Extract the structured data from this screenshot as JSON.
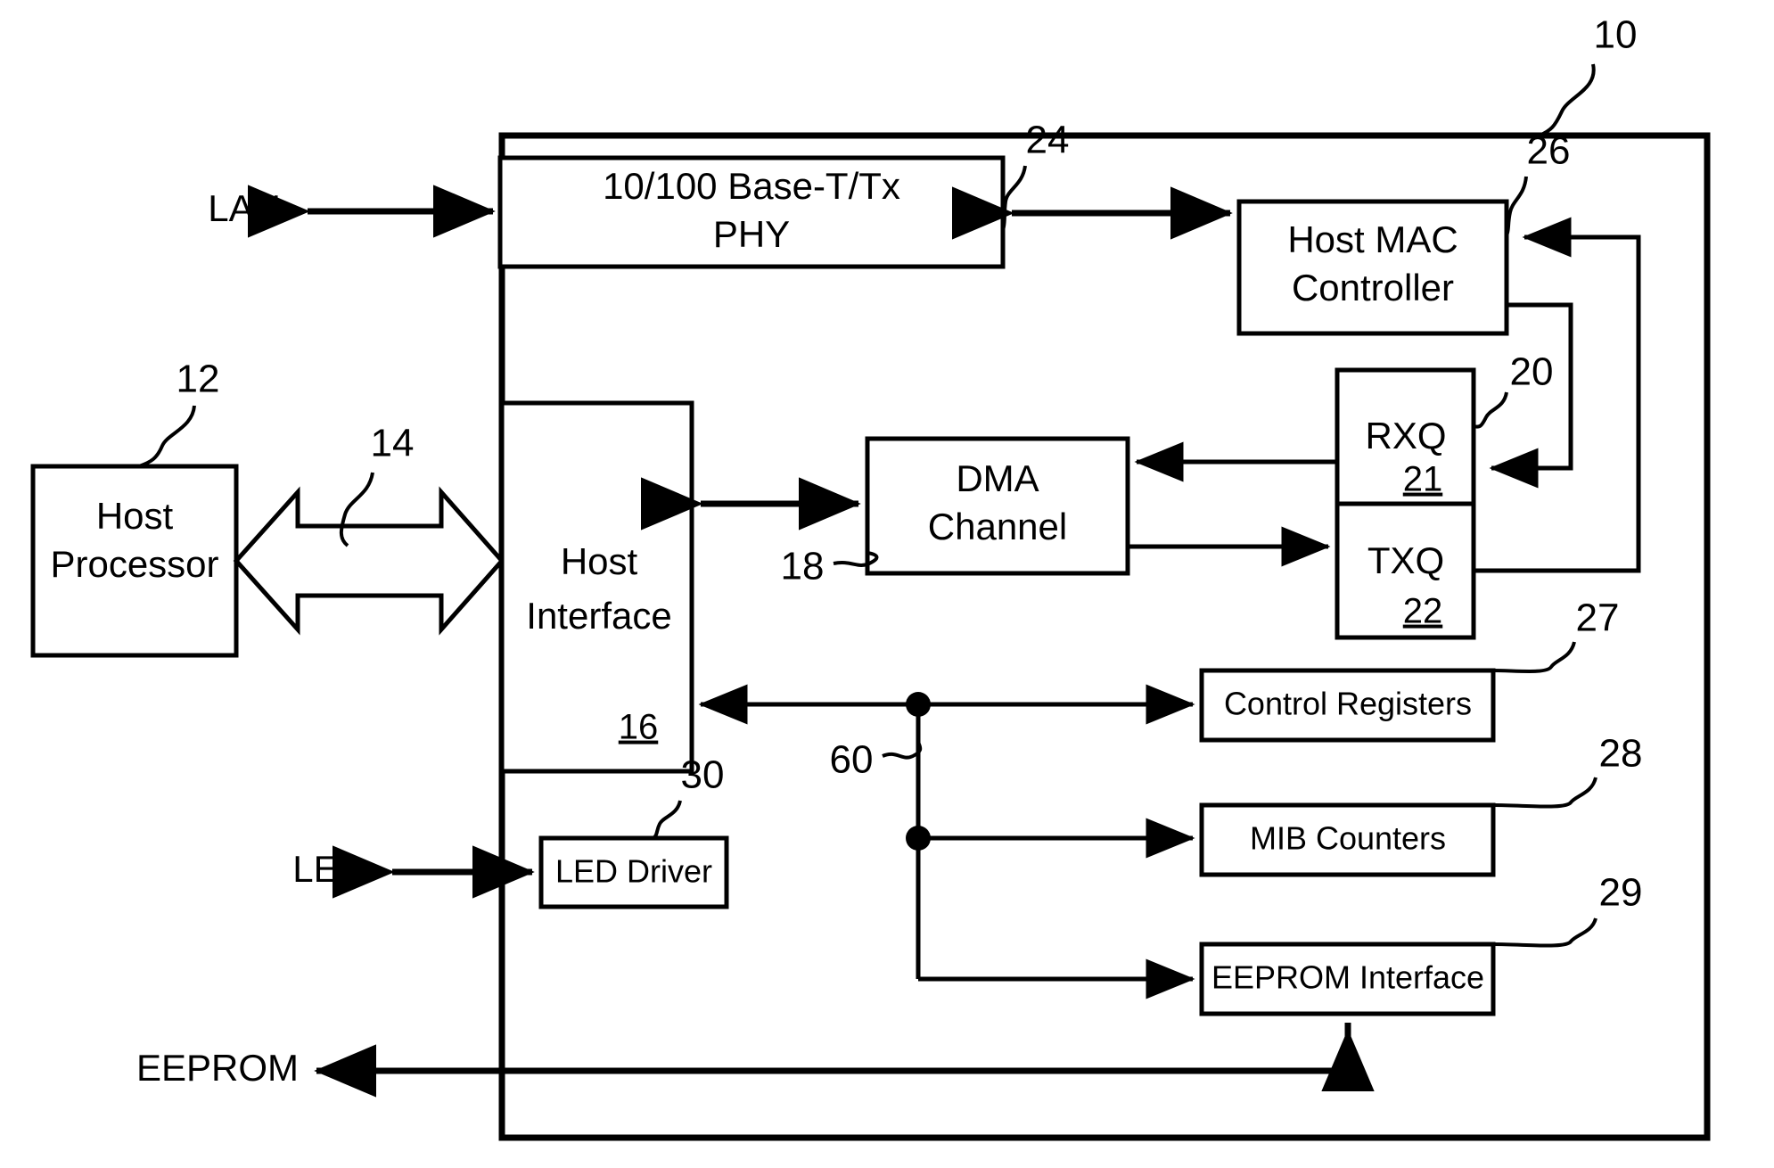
{
  "figure": {
    "type": "patent-block-diagram",
    "reference_numeral_top": "10"
  },
  "ports": [
    {
      "id": "lan",
      "label": "LAN"
    },
    {
      "id": "led",
      "label": "LED"
    },
    {
      "id": "eeprom",
      "label": "EEPROM"
    }
  ],
  "blocks": {
    "host_processor": {
      "line1": "Host",
      "line2": "Processor",
      "ref": "12"
    },
    "host_interface": {
      "line1": "Host",
      "line2": "Interface",
      "ref": "16"
    },
    "phy": {
      "line1": "10/100 Base-T/Tx",
      "line2": "PHY",
      "ref": "24"
    },
    "mac": {
      "line1": "Host MAC",
      "line2": "Controller",
      "ref": "26"
    },
    "dma": {
      "line1": "DMA",
      "line2": "Channel",
      "ref": "18"
    },
    "rxq": {
      "label": "RXQ",
      "ref": "21"
    },
    "txq": {
      "label": "TXQ",
      "ref": "22"
    },
    "queues": {
      "ref": "20"
    },
    "control_registers": {
      "label": "Control Registers",
      "ref": "27"
    },
    "mib_counters": {
      "label": "MIB Counters",
      "ref": "28"
    },
    "eeprom_interface": {
      "label": "EEPROM Interface",
      "ref": "29"
    },
    "led_driver": {
      "label": "LED Driver",
      "ref": "30"
    }
  },
  "connections": {
    "host_bus_ref": "14",
    "internal_bus_ref": "60"
  },
  "colors": {
    "ink": "#000000",
    "paper": "#ffffff"
  }
}
